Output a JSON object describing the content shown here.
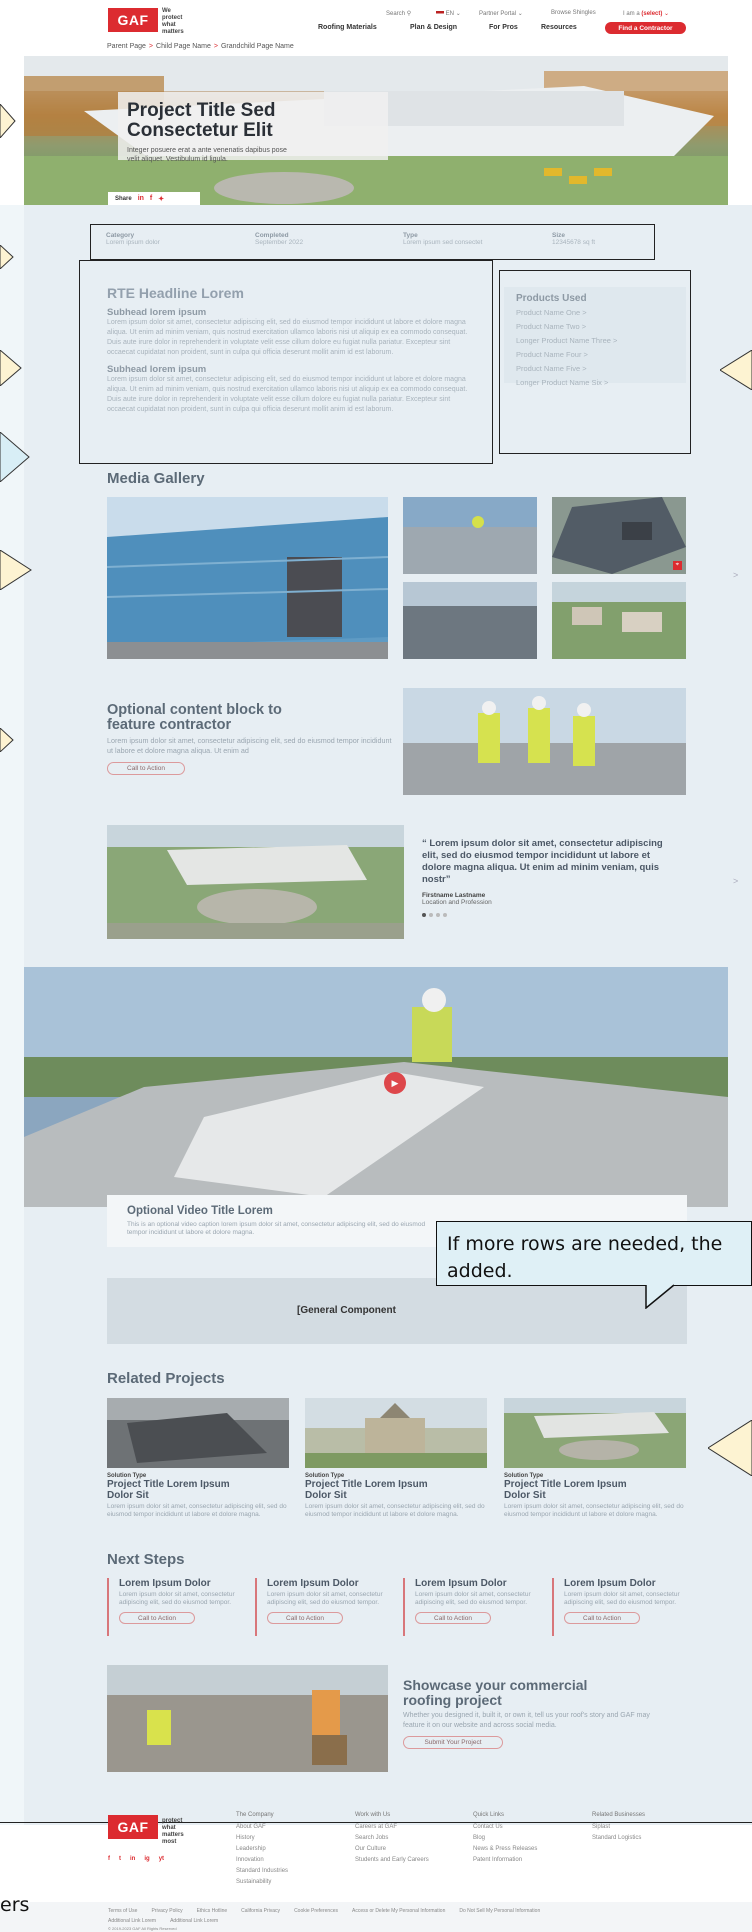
{
  "header": {
    "logo": "GAF",
    "tagline": [
      "We",
      "protect",
      "what",
      "matters",
      "most"
    ],
    "utility": [
      "Search",
      "EN",
      "Partner Portal",
      "Browse Shingles",
      "I am a"
    ],
    "persona": "(select)",
    "nav": [
      "Roofing Materials",
      "Plan & Design",
      "For Pros",
      "Resources"
    ],
    "cta": "Find a Contractor"
  },
  "breadcrumb": [
    "Parent Page",
    "Child Page Name",
    "Grandchild Page Name"
  ],
  "hero": {
    "title_line1": "Project Title Sed",
    "title_line2": "Consectetur Elit",
    "subtitle_line1": "Integer posuere erat a ante venenatis dapibus pose",
    "subtitle_line2": "velit aliquet. Vestibulum id ligula.",
    "share_label": "Share"
  },
  "meta": [
    {
      "label": "Category",
      "value": "Lorem ipsum dolor"
    },
    {
      "label": "Completed",
      "value": "September 2022"
    },
    {
      "label": "Type",
      "value": "Lorem ipsum sed consectet"
    },
    {
      "label": "Size",
      "value": "12345678 sq ft"
    }
  ],
  "rte": {
    "headline": "RTE Headline Lorem",
    "sub1": "Subhead lorem ipsum",
    "para1": "Lorem ipsum dolor sit amet, consectetur adipiscing elit, sed do eiusmod tempor incididunt ut labore et dolore magna aliqua. Ut enim ad minim veniam, quis nostrud exercitation ullamco laboris nisi ut aliquip ex ea commodo consequat. Duis aute irure dolor in reprehenderit in voluptate velit esse cillum dolore eu fugiat nulla pariatur. Excepteur sint occaecat cupidatat non proident, sunt in culpa qui officia deserunt mollit anim id est laborum.",
    "sub2": "Subhead lorem ipsum",
    "para2": "Lorem ipsum dolor sit amet, consectetur adipiscing elit, sed do eiusmod tempor incididunt ut labore et dolore magna aliqua. Ut enim ad minim veniam, quis nostrud exercitation ullamco laboris nisi ut aliquip ex ea commodo consequat. Duis aute irure dolor in reprehenderit in voluptate velit esse cillum dolore eu fugiat nulla pariatur. Excepteur sint occaecat cupidatat non proident, sunt in culpa qui officia deserunt mollit anim id est laborum."
  },
  "products": {
    "heading": "Products Used",
    "items": [
      "Product Name One >",
      "Product Name Two >",
      "Longer Product Name Three >",
      "Product Name Four >",
      "Product Name Five >",
      "Longer Product Name Six >"
    ]
  },
  "gallery": {
    "heading": "Media Gallery",
    "next": ">"
  },
  "feature": {
    "title_line1": "Optional content block to",
    "title_line2": "feature contractor",
    "text": "Lorem ipsum dolor sit amet, consectetur adipiscing elit, sed do eiusmod tempor incididunt ut labore et dolore magna aliqua. Ut enim ad",
    "cta": "Call to Action"
  },
  "testimonial": {
    "quote": "“ Lorem ipsum dolor sit amet, consectetur adipiscing elit, sed do eiusmod tempor incididunt ut labore et dolore magna aliqua. Ut enim ad minim veniam, quis nostr”",
    "name": "Firstname Lastname",
    "role": "Location and Profession",
    "next": ">"
  },
  "video": {
    "title": "Optional Video Title Lorem",
    "caption": "This is an optional video caption lorem ipsum dolor sit amet, consectetur adipiscing elit, sed do eiusmod tempor incididunt ut labore et dolore magna."
  },
  "general_component": "[General Component",
  "callout": {
    "line1": "If more rows are needed, the",
    "line2": "added."
  },
  "related": {
    "heading": "Related Projects",
    "items": [
      {
        "type": "Solution Type",
        "title1": "Project Title Lorem Ipsum",
        "title2": "Dolor Sit",
        "desc": "Lorem ipsum dolor sit amet, consectetur adipiscing elit, sed do eiusmod tempor incididunt ut labore et dolore magna."
      },
      {
        "type": "Solution Type",
        "title1": "Project Title Lorem Ipsum",
        "title2": "Dolor Sit",
        "desc": "Lorem ipsum dolor sit amet, consectetur adipiscing elit, sed do eiusmod tempor incididunt ut labore et dolore magna."
      },
      {
        "type": "Solution Type",
        "title1": "Project Title Lorem Ipsum",
        "title2": "Dolor Sit",
        "desc": "Lorem ipsum dolor sit amet, consectetur adipiscing elit, sed do eiusmod tempor incididunt ut labore et dolore magna."
      }
    ]
  },
  "next_steps": {
    "heading": "Next Steps",
    "items": [
      {
        "title": "Lorem Ipsum Dolor",
        "text": "Lorem ipsum dolor sit amet, consectetur adipiscing elit, sed do eiusmod tempor.",
        "cta": "Call to Action"
      },
      {
        "title": "Lorem Ipsum Dolor",
        "text": "Lorem ipsum dolor sit amet, consectetur adipiscing elit, sed do eiusmod tempor.",
        "cta": "Call to Action"
      },
      {
        "title": "Lorem Ipsum Dolor",
        "text": "Lorem ipsum dolor sit amet, consectetur adipiscing elit, sed do eiusmod tempor.",
        "cta": "Call to Action"
      },
      {
        "title": "Lorem Ipsum Dolor",
        "text": "Lorem ipsum dolor sit amet, consectetur adipiscing elit, sed do eiusmod tempor.",
        "cta": "Call to Action"
      }
    ]
  },
  "showcase": {
    "title_line1": "Showcase your commercial",
    "title_line2": "roofing project",
    "text": "Whether you designed it, built it, or own it, tell us your roof's story and GAF may feature it on our website and across social media.",
    "cta": "Submit Your Project"
  },
  "footer": {
    "cols": [
      {
        "heading": "The Company",
        "links": [
          "About GAF",
          "History",
          "Leadership",
          "Innovation",
          "Standard Industries",
          "Sustainability"
        ]
      },
      {
        "heading": "Work with Us",
        "links": [
          "Careers at GAF",
          "Search Jobs",
          "Our Culture",
          "Students and Early Careers"
        ]
      },
      {
        "heading": "Quick Links",
        "links": [
          "Contact Us",
          "Blog",
          "News & Press Releases",
          "Patent Information"
        ]
      },
      {
        "heading": "Related Businesses",
        "links": [
          "Siplast",
          "Standard Logistics"
        ]
      }
    ],
    "social": [
      "f",
      "t",
      "in",
      "ig",
      "yt"
    ],
    "bottom_links": [
      "Terms of Use",
      "Privacy Policy",
      "Ethics Hotline",
      "California Privacy",
      "Cookie Preferences",
      "Access or Delete My Personal Information",
      "Do Not Sell My Personal Information"
    ],
    "extra_links": [
      "Additional Link Lorem",
      "Additional Link Lorem"
    ],
    "copyright": "© 2019-2023 GAF All Rights Reserved"
  },
  "edge_text": "ers"
}
